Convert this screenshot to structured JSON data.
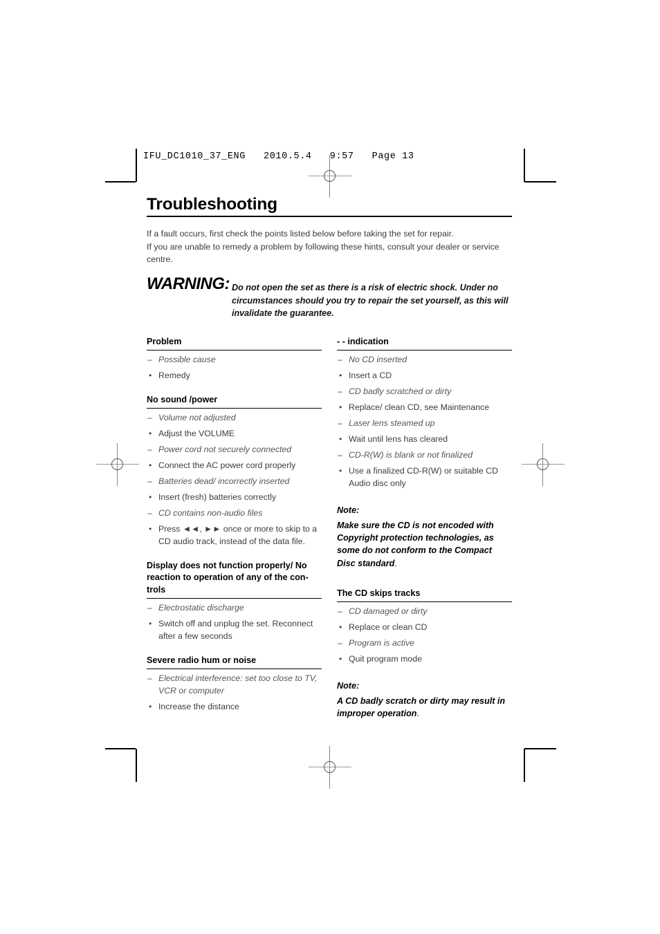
{
  "print_slug": "IFU_DC1010_37_ENG   2010.5.4   9:57   Page 13",
  "page_title": "Troubleshooting",
  "intro": {
    "line1": "If a fault occurs, first check the points listed below before taking the set for repair.",
    "line2": "If you are unable to remedy a problem by following these hints, consult your dealer or service centre."
  },
  "warning": {
    "label": "WARNING:",
    "text": "Do not open the set as there is a risk of electric shock. Under no circumstances should you try to repair the set yourself, as this will invalidate the guarantee."
  },
  "left_column": {
    "sections": [
      {
        "heading": "Problem",
        "items": [
          {
            "type": "cause",
            "mark": "–",
            "text": "Possible cause"
          },
          {
            "type": "remedy",
            "mark": "•",
            "text": "Remedy"
          }
        ]
      },
      {
        "heading": "No sound /power",
        "items": [
          {
            "type": "cause",
            "mark": "–",
            "text": "Volume not adjusted"
          },
          {
            "type": "remedy",
            "mark": "•",
            "text": "Adjust the VOLUME"
          },
          {
            "type": "cause",
            "mark": "–",
            "text": "Power cord not securely connected"
          },
          {
            "type": "remedy",
            "mark": "•",
            "text": "Connect the AC power cord properly"
          },
          {
            "type": "cause",
            "mark": "–",
            "text": "Batteries dead/ incorrectly inserted"
          },
          {
            "type": "remedy",
            "mark": "•",
            "text": "Insert (fresh) batteries correctly"
          },
          {
            "type": "cause",
            "mark": "–",
            "text": "CD contains non-audio files"
          },
          {
            "type": "remedy",
            "mark": "•",
            "text": "Press ◄◄, ►► once or more to skip to a CD audio track, instead of the data file."
          }
        ]
      },
      {
        "heading": "Display does not function properly/ No reaction to operation of any of the con-trols",
        "items": [
          {
            "type": "cause",
            "mark": "–",
            "text": "Electrostatic discharge"
          },
          {
            "type": "remedy",
            "mark": "•",
            "text": "Switch off and unplug the set. Reconnect after a few seconds"
          }
        ]
      },
      {
        "heading": "Severe radio hum or noise",
        "items": [
          {
            "type": "cause",
            "mark": "–",
            "text": "Electrical interference: set too close to TV, VCR or computer"
          },
          {
            "type": "remedy",
            "mark": "•",
            "text": "Increase the distance"
          }
        ]
      }
    ]
  },
  "right_column": {
    "sections": [
      {
        "heading": "- - indication",
        "items": [
          {
            "type": "cause",
            "mark": "–",
            "text": "No CD inserted"
          },
          {
            "type": "remedy",
            "mark": "•",
            "text": "Insert a CD"
          },
          {
            "type": "cause",
            "mark": "–",
            "text": "CD badly scratched or dirty"
          },
          {
            "type": "remedy",
            "mark": "•",
            "text": "Replace/ clean CD, see Maintenance"
          },
          {
            "type": "cause",
            "mark": "–",
            "text": "Laser lens steamed up"
          },
          {
            "type": "remedy",
            "mark": "•",
            "text": "Wait until lens has cleared"
          },
          {
            "type": "cause",
            "mark": "–",
            "text": "CD-R(W) is blank or not finalized"
          },
          {
            "type": "remedy",
            "mark": "•",
            "text": "Use a finalized CD-R(W) or suitable CD Audio disc only"
          }
        ]
      }
    ],
    "note1": {
      "label": "Note:",
      "body": "Make sure the CD is not encoded with Copyright protection technologies, as some do not conform to the Compact Disc standard",
      "tail": "."
    },
    "section2": {
      "heading": "The CD skips tracks",
      "items": [
        {
          "type": "cause",
          "mark": "–",
          "text": "CD damaged or dirty"
        },
        {
          "type": "remedy",
          "mark": "•",
          "text": "Replace or clean CD"
        },
        {
          "type": "cause",
          "mark": "–",
          "text": "Program is active"
        },
        {
          "type": "remedy",
          "mark": "•",
          "text": "Quit program mode"
        }
      ]
    },
    "note2": {
      "label": "Note:",
      "body": "A CD badly scratch or dirty may result in improper operation",
      "tail": "."
    }
  }
}
